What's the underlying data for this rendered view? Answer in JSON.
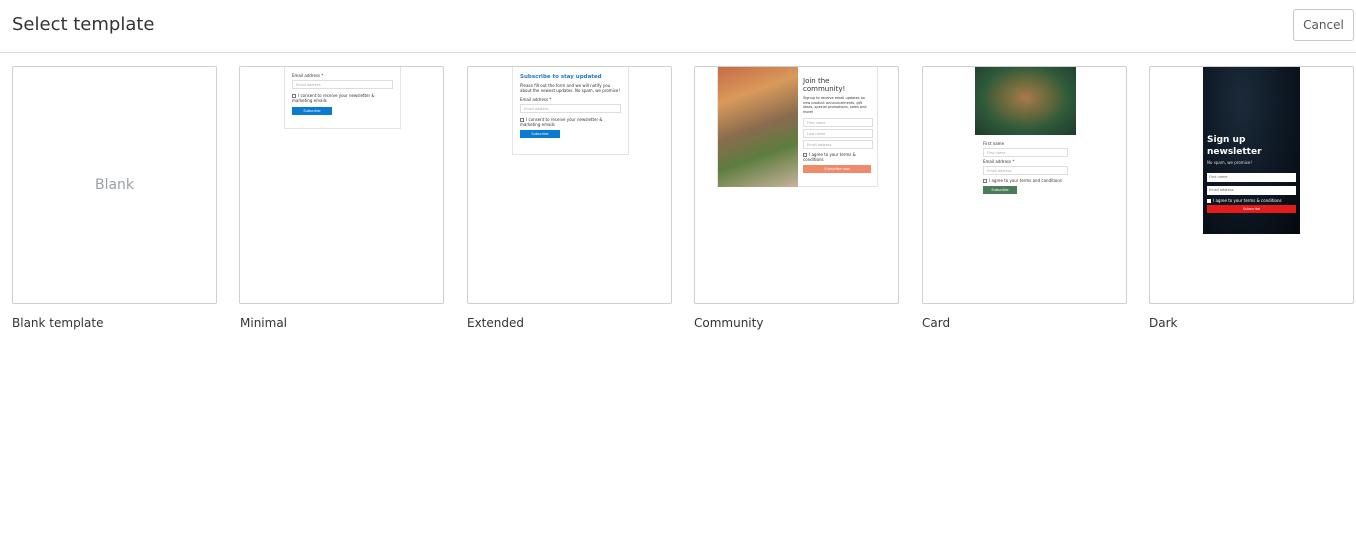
{
  "header": {
    "title": "Select template",
    "cancel_label": "Cancel"
  },
  "templates": [
    {
      "name": "Blank template",
      "preview_text": "Blank"
    },
    {
      "name": "Minimal",
      "preview": {
        "email_label": "Email address *",
        "email_placeholder": "Email address",
        "consent": "I consent to receive your newsletter & marketing emails",
        "button": "Subscribe",
        "accent": "#0a7bd3"
      }
    },
    {
      "name": "Extended",
      "preview": {
        "title": "Subscribe to stay updated",
        "text": "Please fill out the form and we will notify you about the newest updates. No spam, we promise!",
        "email_label": "Email address *",
        "email_placeholder": "Email address",
        "consent": "I consent to receive your newsletter & marketing emails",
        "button": "Subscribe",
        "accent": "#0a7bd3"
      }
    },
    {
      "name": "Community",
      "preview": {
        "title": "Join the community!",
        "text": "Signup to receive email updates on new product announcements, gift ideas, special promotions, sales and more!",
        "first_name": "First name",
        "last_name": "Last name",
        "email": "Email address",
        "consent": "I agree to your terms & conditions",
        "button": "Subscribe now",
        "accent": "#f08a6c"
      }
    },
    {
      "name": "Card",
      "preview": {
        "first_name_label": "First name",
        "first_name_placeholder": "First name",
        "email_label": "Email address *",
        "email_placeholder": "Email address",
        "consent": "I agree to your terms and conditions",
        "button": "Subscribe",
        "accent": "#4a7c59"
      }
    },
    {
      "name": "Dark",
      "preview": {
        "title": "Sign up newsletter",
        "subtitle": "No spam, we promise!",
        "first_name": "First name",
        "email": "Email address",
        "consent": "I agree to your terms & conditions",
        "button": "Subscribe",
        "accent": "#e41b1b"
      }
    }
  ]
}
